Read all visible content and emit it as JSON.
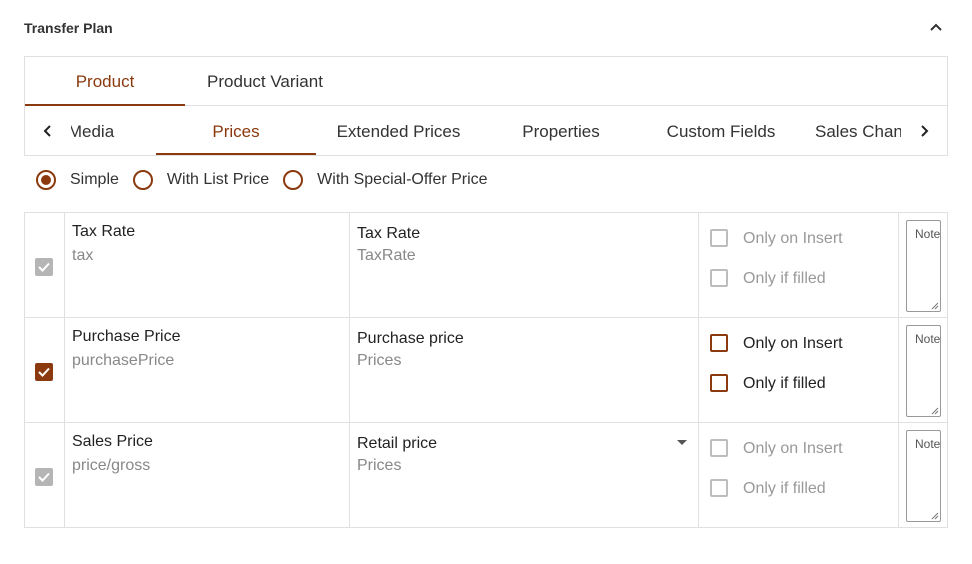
{
  "panel": {
    "title": "Transfer Plan"
  },
  "main_tabs": [
    {
      "label": "Product"
    },
    {
      "label": "Product Variant"
    }
  ],
  "sub_tabs": [
    {
      "label": "Media"
    },
    {
      "label": "Prices"
    },
    {
      "label": "Extended Prices"
    },
    {
      "label": "Properties"
    },
    {
      "label": "Custom Fields"
    },
    {
      "label": "Sales Channels"
    }
  ],
  "price_mode": {
    "options": [
      {
        "label": "Simple",
        "checked": true
      },
      {
        "label": "With List Price",
        "checked": false
      },
      {
        "label": "With Special-Offer Price",
        "checked": false
      }
    ]
  },
  "rows": [
    {
      "enabled_state": "checked-disabled",
      "source_label": "Tax Rate",
      "source_key": "tax",
      "target_label": "Tax Rate",
      "target_group": "TaxRate",
      "only_on_insert": "Only on Insert",
      "only_if_filled": "Only if filled",
      "note_placeholder": "Note"
    },
    {
      "enabled_state": "checked",
      "source_label": "Purchase Price",
      "source_key": "purchasePrice",
      "target_label": "Purchase price",
      "target_group": "Prices",
      "only_on_insert": "Only on Insert",
      "only_if_filled": "Only if filled",
      "note_placeholder": "Note"
    },
    {
      "enabled_state": "checked-disabled",
      "source_label": "Sales Price",
      "source_key": "price/gross",
      "target_label": "Retail price",
      "target_group": "Prices",
      "only_on_insert": "Only on Insert",
      "only_if_filled": "Only if filled",
      "note_placeholder": "Note"
    }
  ],
  "colors": {
    "accent": "#8a3a0e",
    "disabled": "#b5b5b5",
    "border": "#e0e0e0"
  }
}
